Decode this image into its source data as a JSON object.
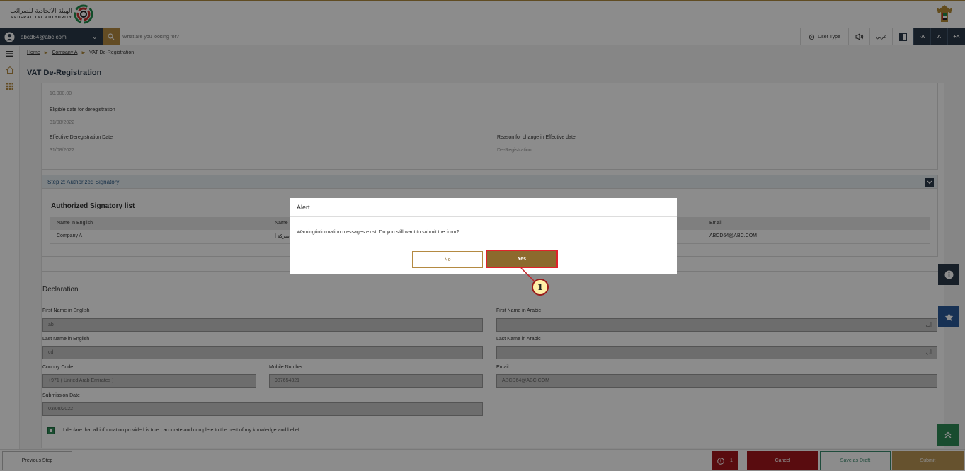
{
  "header": {
    "logo_ar": "الهيئة الاتحادية للضرائب",
    "logo_en": "FEDERAL TAX AUTHORITY"
  },
  "navbar": {
    "user_email": "abcd64@abc.com",
    "search_placeholder": "What are you looking for?",
    "user_type": "User Type",
    "language": "عربي",
    "font_decrease": "-A",
    "font_normal": "A",
    "font_increase": "+A"
  },
  "breadcrumb": {
    "home": "Home",
    "company": "Company A",
    "current": "VAT De-Registration"
  },
  "page_title": "VAT De-Registration",
  "section1": {
    "amount_value": "10,000.00",
    "eligible_label": "Eligible date for deregistration",
    "eligible_value": "31/08/2022",
    "effective_label": "Effective Deregistration Date",
    "effective_value": "31/08/2022",
    "reason_label": "Reason for change in Effective date",
    "reason_value": "De-Registration"
  },
  "step2": {
    "title": "Step 2: Authorized Signatory",
    "list_title": "Authorized Signatory list",
    "columns": [
      "Name in English",
      "Name",
      "Email"
    ],
    "rows": [
      {
        "name_en": "Company A",
        "name_ar": "شركة أ",
        "email": "ABCD64@ABC.COM"
      }
    ]
  },
  "declaration": {
    "title": "Declaration",
    "first_name_en_label": "First Name in English",
    "first_name_en_value": "ab",
    "first_name_ar_label": "First Name in Arabic",
    "first_name_ar_value": "أب",
    "last_name_en_label": "Last Name in English",
    "last_name_en_value": "cd",
    "last_name_ar_label": "Last Name in Arabic",
    "last_name_ar_value": "أب",
    "country_code_label": "Country Code",
    "country_code_value": "+971 ( United Arab Emirates )",
    "mobile_label": "Mobile Number",
    "mobile_value": "987654321",
    "email_label": "Email",
    "email_value": "ABCD64@ABC.COM",
    "submission_date_label": "Submission Date",
    "submission_date_value": "03/08/2022",
    "declare_text": "I declare that all information provided is true , accurate and complete to the best of my knowledge and belief"
  },
  "bottom": {
    "previous": "Previous Step",
    "warning_count": "1",
    "cancel": "Cancel",
    "save_draft": "Save as Draft",
    "submit": "Submit"
  },
  "modal": {
    "title": "Alert",
    "message": "Warning/information messages exist. Do you still want to submit the form?",
    "no": "No",
    "yes": "Yes"
  },
  "callout": "1",
  "colors": {
    "navy": "#2b3a4a",
    "gold": "#b48a42",
    "danger": "#a3161c",
    "green": "#3a8a6e",
    "highlight": "#e0232b"
  }
}
